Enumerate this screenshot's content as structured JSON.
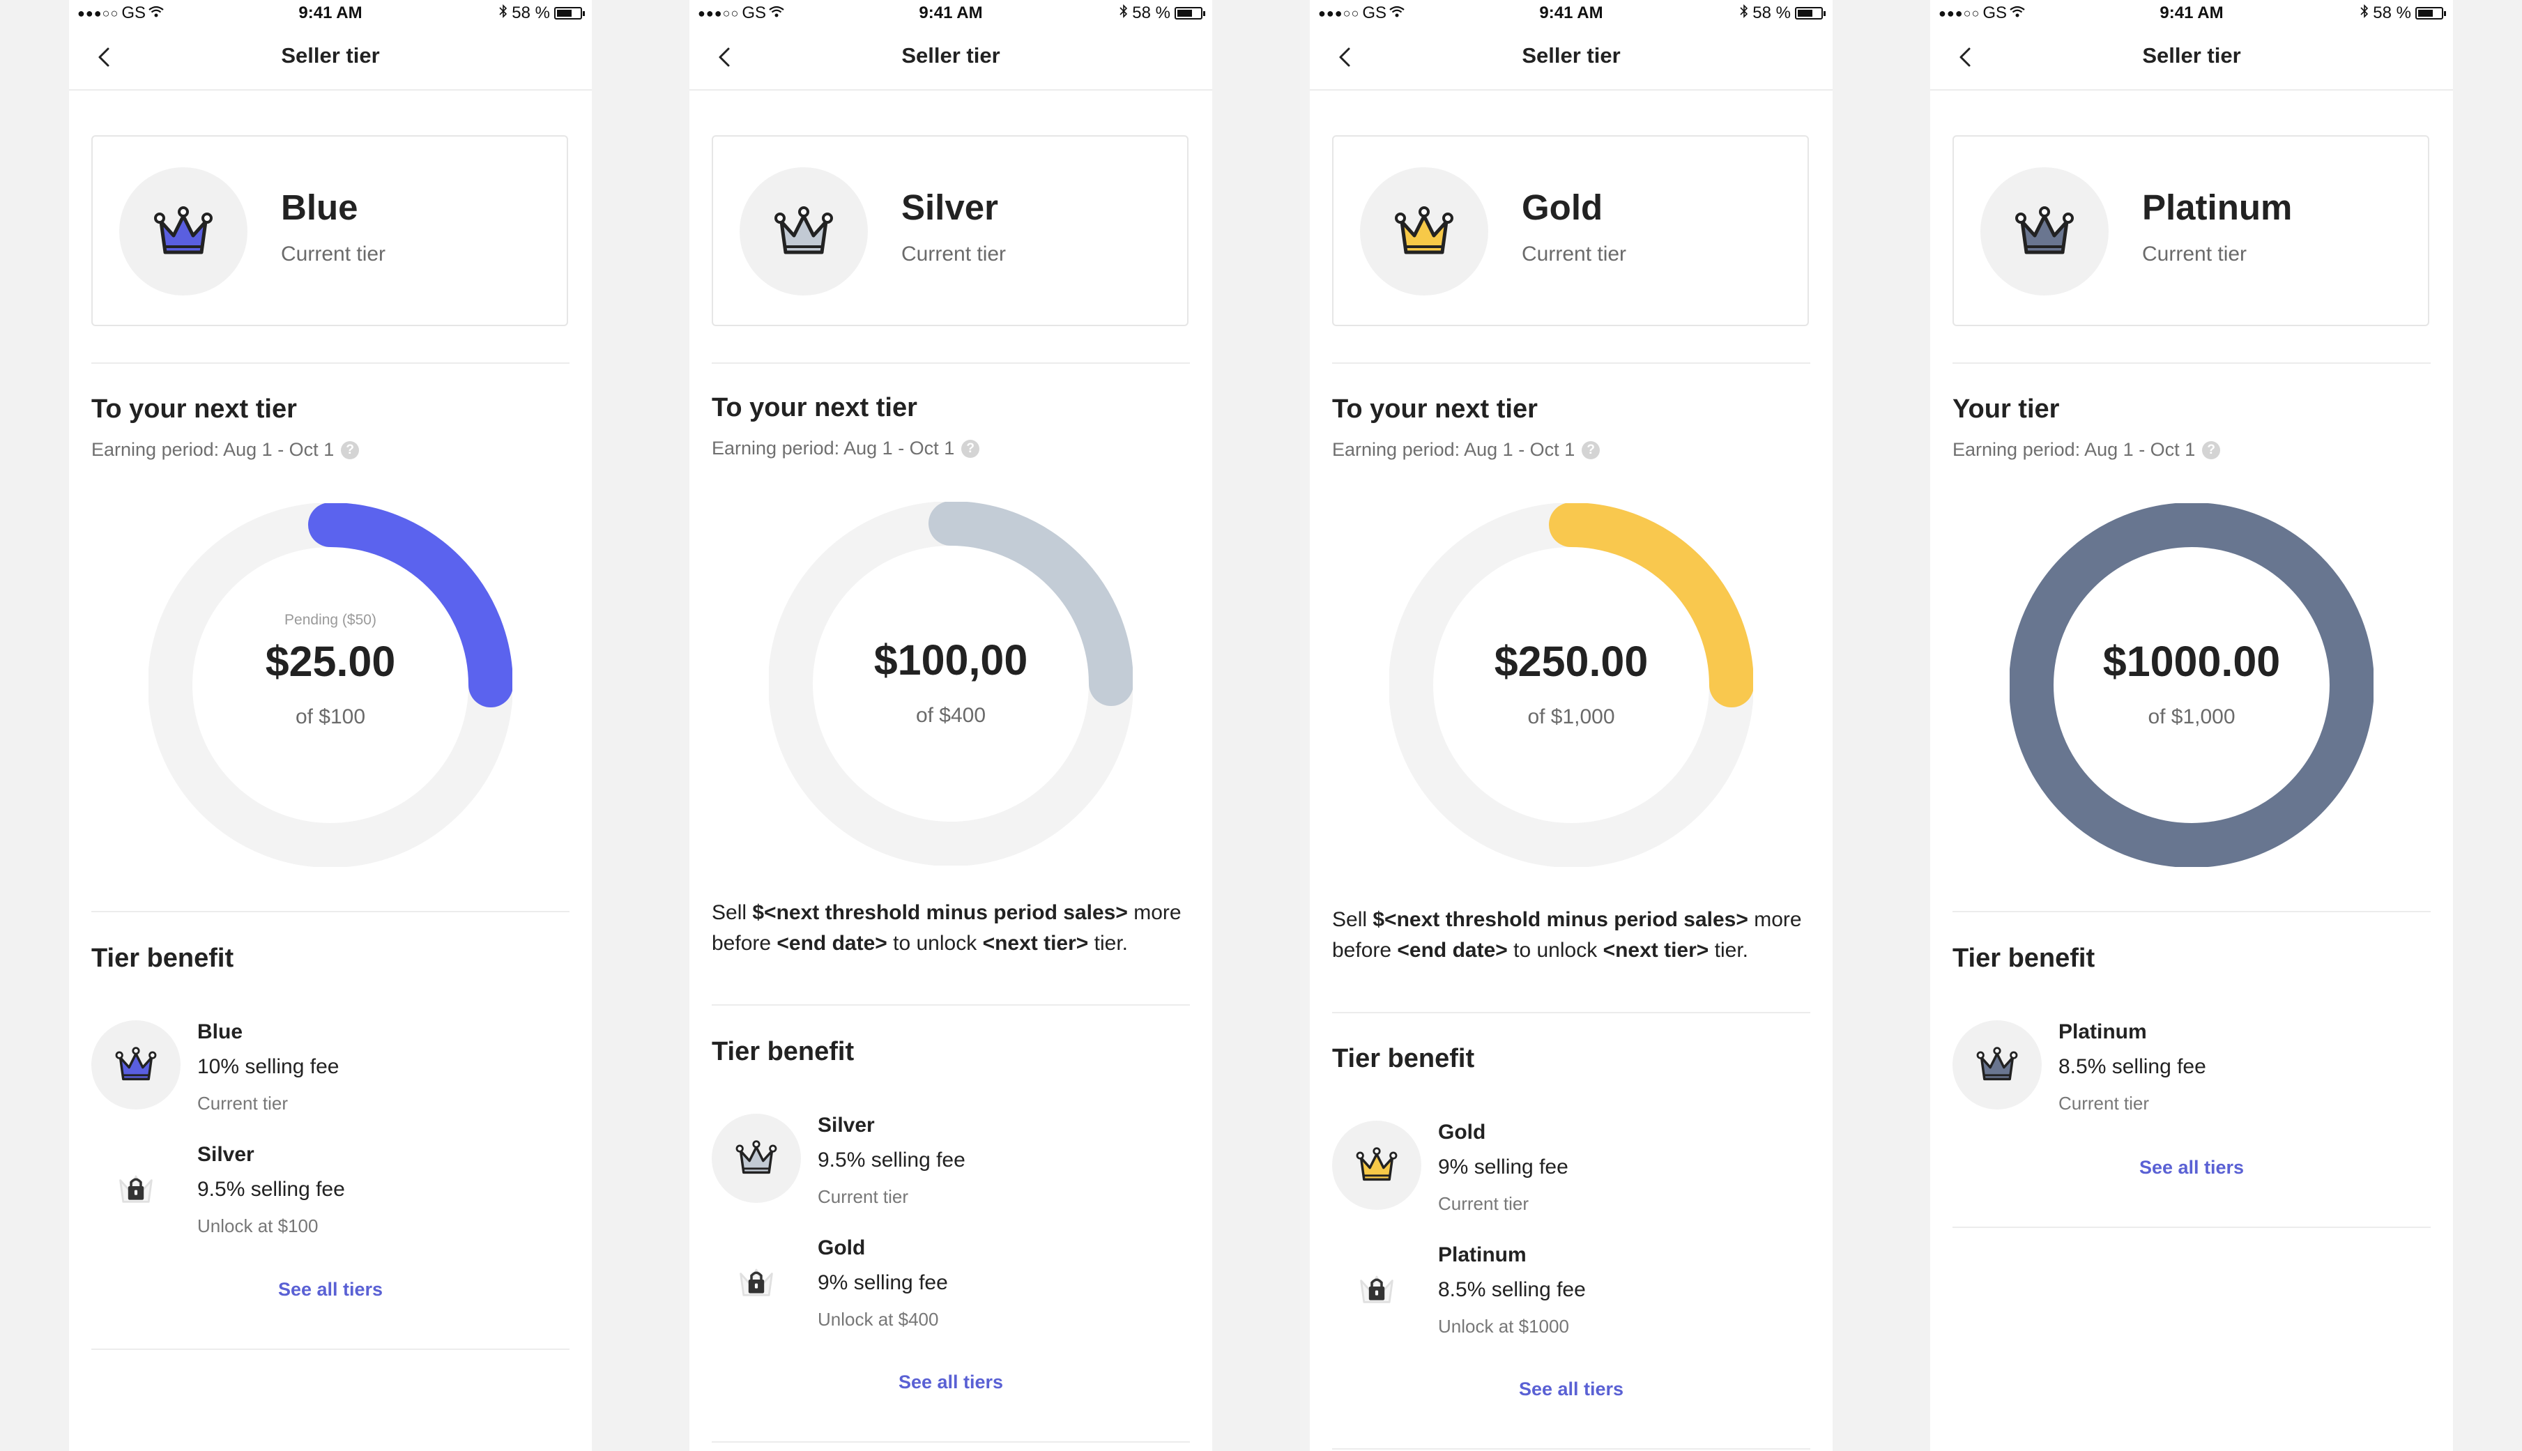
{
  "status_bar": {
    "signal": "●●●○○",
    "carrier": "GS",
    "time": "9:41 AM",
    "battery": "58 %"
  },
  "nav_title": "Seller tier",
  "screens": [
    {
      "tier": "Blue",
      "tier_sub": "Current tier",
      "crown_color": "#5a5fe0",
      "section_title": "To your next tier",
      "period": "Earning period: Aug 1 - Oct 1",
      "progress": {
        "pending": "Pending ($50)",
        "amount": "$25.00",
        "of": "of $100",
        "fraction": 0.25,
        "color": "#5b63ee"
      },
      "message": null,
      "benefit_title": "Tier benefit",
      "benefits": [
        {
          "name": "Blue",
          "fee": "10% selling fee",
          "status": "Current tier",
          "locked": false
        },
        {
          "name": "Silver",
          "fee": "9.5% selling fee",
          "status": "Unlock at $100",
          "locked": true
        }
      ],
      "see_all": "See all tiers"
    },
    {
      "tier": "Silver",
      "tier_sub": "Current tier",
      "crown_color": "#c2cad4",
      "section_title": "To your next tier",
      "period": "Earning period: Aug 1 - Oct 1",
      "progress": {
        "pending": "",
        "amount": "$100,00",
        "of": "of $400",
        "fraction": 0.25,
        "color": "#c3ccd6"
      },
      "message": {
        "a": "Sell ",
        "b": "$<next threshold minus period sales>",
        "c": " more before ",
        "d": "<end date>",
        "e": " to unlock ",
        "f": "<next tier>",
        "g": " tier."
      },
      "benefit_title": "Tier benefit",
      "benefits": [
        {
          "name": "Silver",
          "fee": "9.5% selling fee",
          "status": "Current tier",
          "locked": false
        },
        {
          "name": "Gold",
          "fee": "9% selling fee",
          "status": "Unlock at $400",
          "locked": true
        }
      ],
      "see_all": "See all tiers"
    },
    {
      "tier": "Gold",
      "tier_sub": "Current tier",
      "crown_color": "#f7c948",
      "section_title": "To your next tier",
      "period": "Earning period: Aug 1 - Oct 1",
      "progress": {
        "pending": "",
        "amount": "$250.00",
        "of": "of $1,000",
        "fraction": 0.25,
        "color": "#f9c84e"
      },
      "message": {
        "a": "Sell ",
        "b": "$<next threshold minus period sales>",
        "c": " more before ",
        "d": "<end date>",
        "e": " to unlock ",
        "f": "<next tier>",
        "g": " tier."
      },
      "benefit_title": "Tier benefit",
      "benefits": [
        {
          "name": "Gold",
          "fee": "9% selling fee",
          "status": "Current tier",
          "locked": false
        },
        {
          "name": "Platinum",
          "fee": "8.5% selling fee",
          "status": "Unlock at $1000",
          "locked": true
        }
      ],
      "see_all": "See all tiers"
    },
    {
      "tier": "Platinum",
      "tier_sub": "Current tier",
      "crown_color": "#6a7690",
      "section_title": "Your tier",
      "period": "Earning period: Aug 1 - Oct 1",
      "progress": {
        "pending": "",
        "amount": "$1000.00",
        "of": "of $1,000",
        "fraction": 1.0,
        "color": "#687690"
      },
      "message": null,
      "benefit_title": "Tier benefit",
      "benefits": [
        {
          "name": "Platinum",
          "fee": "8.5% selling fee",
          "status": "Current tier",
          "locked": false
        }
      ],
      "see_all": "See all tiers"
    }
  ]
}
